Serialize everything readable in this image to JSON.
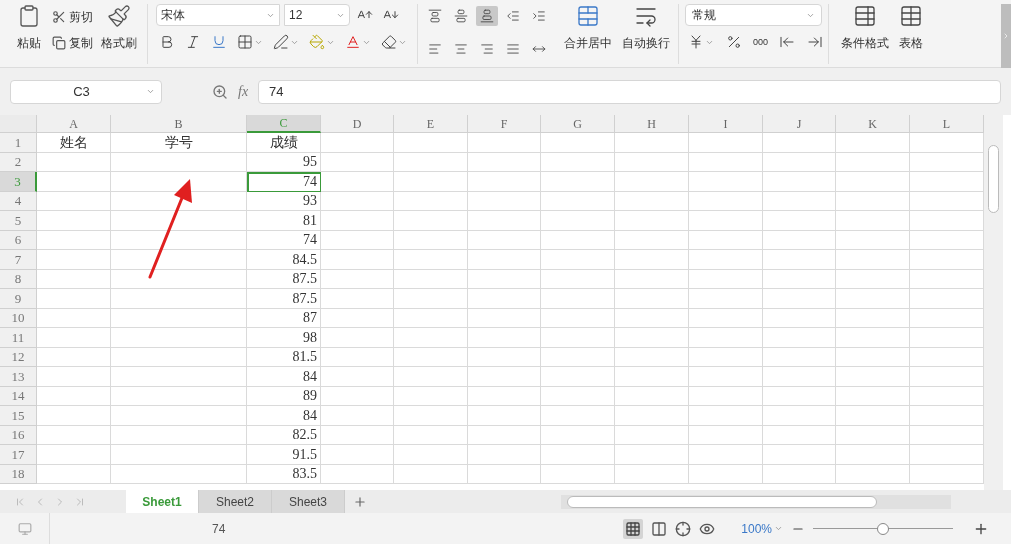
{
  "ribbon": {
    "clipboard": {
      "paste": "粘贴",
      "cut": "剪切",
      "copy": "复制",
      "format_painter": "格式刷"
    },
    "font": {
      "name": "宋体",
      "size": "12"
    },
    "alignment": [
      {
        "kind": "top",
        "selected": false
      },
      {
        "kind": "middle",
        "selected": false
      },
      {
        "kind": "bottom",
        "selected": true
      },
      {
        "kind": "outdent",
        "selected": false
      },
      {
        "kind": "indent",
        "selected": false
      },
      {
        "kind": "left",
        "selected": false
      },
      {
        "kind": "center",
        "selected": false
      },
      {
        "kind": "right",
        "selected": false
      },
      {
        "kind": "justify",
        "selected": false
      },
      {
        "kind": "distribute",
        "selected": false
      }
    ],
    "merge": "合并居中",
    "wrap": "自动换行",
    "number_format": "常规",
    "thousands": "000",
    "conditional_format": "条件格式",
    "table_style": "表格"
  },
  "formula_bar": {
    "name_box": "C3",
    "function_label": "fx",
    "value": "74"
  },
  "columns": [
    {
      "label": "A",
      "selected": false
    },
    {
      "label": "B",
      "selected": false
    },
    {
      "label": "C",
      "selected": true
    },
    {
      "label": "D",
      "selected": false
    },
    {
      "label": "E",
      "selected": false
    },
    {
      "label": "F",
      "selected": false
    },
    {
      "label": "G",
      "selected": false
    },
    {
      "label": "H",
      "selected": false
    },
    {
      "label": "I",
      "selected": false
    },
    {
      "label": "J",
      "selected": false
    },
    {
      "label": "K",
      "selected": false
    },
    {
      "label": "L",
      "selected": false
    }
  ],
  "rows": [
    {
      "header": "1",
      "selected": false,
      "cells": [
        "姓名",
        "学号",
        "成绩"
      ]
    },
    {
      "header": "2",
      "selected": false,
      "cells": [
        "",
        "",
        "95"
      ]
    },
    {
      "header": "3",
      "selected": true,
      "cells": [
        "",
        "",
        "74"
      ]
    },
    {
      "header": "4",
      "selected": false,
      "cells": [
        "",
        "",
        "93"
      ]
    },
    {
      "header": "5",
      "selected": false,
      "cells": [
        "",
        "",
        "81"
      ]
    },
    {
      "header": "6",
      "selected": false,
      "cells": [
        "",
        "",
        "74"
      ]
    },
    {
      "header": "7",
      "selected": false,
      "cells": [
        "",
        "",
        "84.5"
      ]
    },
    {
      "header": "8",
      "selected": false,
      "cells": [
        "",
        "",
        "87.5"
      ]
    },
    {
      "header": "9",
      "selected": false,
      "cells": [
        "",
        "",
        "87.5"
      ]
    },
    {
      "header": "10",
      "selected": false,
      "cells": [
        "",
        "",
        "87"
      ]
    },
    {
      "header": "11",
      "selected": false,
      "cells": [
        "",
        "",
        "98"
      ]
    },
    {
      "header": "12",
      "selected": false,
      "cells": [
        "",
        "",
        "81.5"
      ]
    },
    {
      "header": "13",
      "selected": false,
      "cells": [
        "",
        "",
        "84"
      ]
    },
    {
      "header": "14",
      "selected": false,
      "cells": [
        "",
        "",
        "89"
      ]
    },
    {
      "header": "15",
      "selected": false,
      "cells": [
        "",
        "",
        "84"
      ]
    },
    {
      "header": "16",
      "selected": false,
      "cells": [
        "",
        "",
        "82.5"
      ]
    },
    {
      "header": "17",
      "selected": false,
      "cells": [
        "",
        "",
        "91.5"
      ]
    },
    {
      "header": "18",
      "selected": false,
      "cells": [
        "",
        "",
        "83.5"
      ]
    }
  ],
  "sheet_tabs": [
    {
      "label": "Sheet1",
      "selected": true
    },
    {
      "label": "Sheet2",
      "selected": false
    },
    {
      "label": "Sheet3",
      "selected": false
    }
  ],
  "status_bar": {
    "value": "74",
    "zoom": "100%",
    "zoom_slider": {
      "level": 0.5
    }
  }
}
